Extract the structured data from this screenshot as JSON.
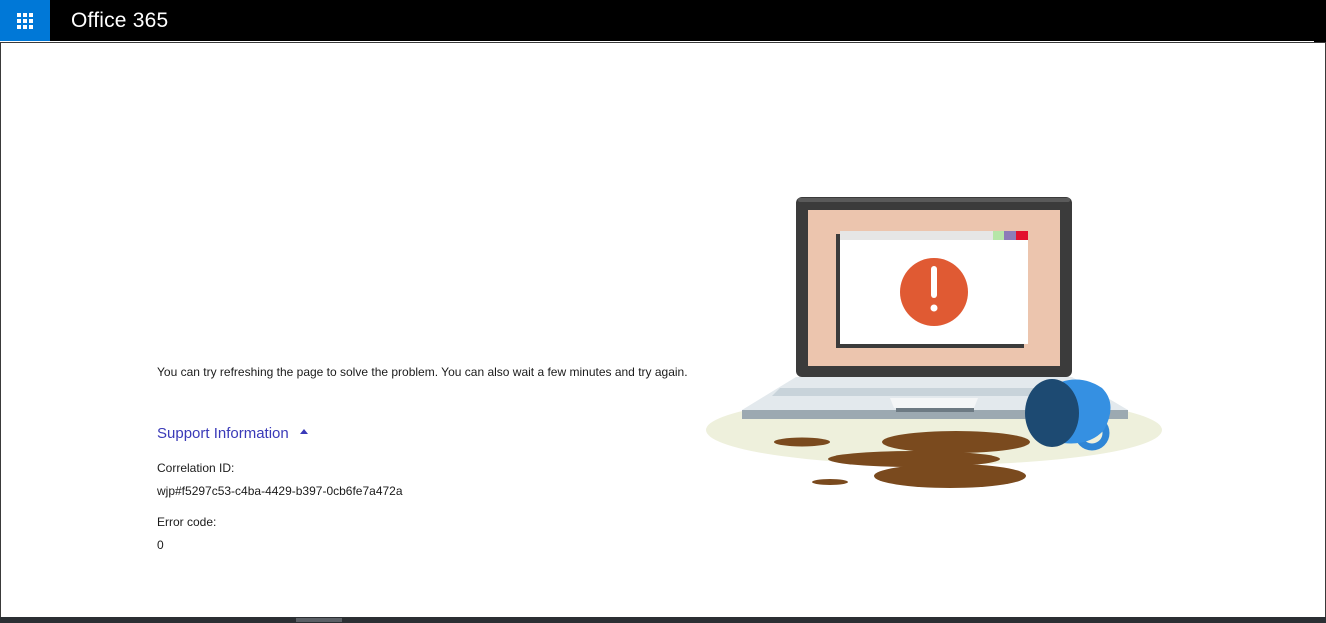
{
  "header": {
    "app_title": "Office 365",
    "app_launcher_icon": "waffle-grid-icon",
    "accent_color": "#0078d7",
    "bar_color": "#000000"
  },
  "error": {
    "message": "You can try refreshing the page to solve the problem. You can also wait a few minutes and try again.",
    "illustration": "laptop-spilled-coffee-error-illustration",
    "alert_color": "#e05a33"
  },
  "support": {
    "toggle_label": "Support Information",
    "toggle_icon": "caret-up-icon",
    "link_color": "#3a3ab8",
    "correlation_label": "Correlation ID:",
    "correlation_value": "wjp#f5297c53-c4ba-4429-b397-0cb6fe7a472a",
    "error_code_label": "Error code:",
    "error_code_value": "0"
  }
}
